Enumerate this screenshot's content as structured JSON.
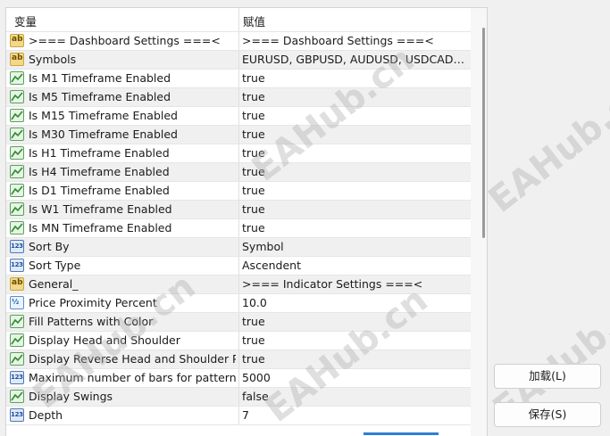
{
  "header": {
    "col_name": "变量",
    "col_value": "赋值"
  },
  "rows": [
    {
      "icon": "string",
      "name": ">=== Dashboard Settings ===<",
      "value": ">=== Dashboard Settings ===<"
    },
    {
      "icon": "string",
      "name": "Symbols",
      "value": "EURUSD, GBPUSD, AUDUSD, USDCAD, USDCHF"
    },
    {
      "icon": "bool",
      "name": "Is M1 Timeframe Enabled",
      "value": "true"
    },
    {
      "icon": "bool",
      "name": "Is M5 Timeframe Enabled",
      "value": "true"
    },
    {
      "icon": "bool",
      "name": "Is M15 Timeframe Enabled",
      "value": "true"
    },
    {
      "icon": "bool",
      "name": "Is M30 Timeframe Enabled",
      "value": "true"
    },
    {
      "icon": "bool",
      "name": "Is H1 Timeframe Enabled",
      "value": "true"
    },
    {
      "icon": "bool",
      "name": "Is H4 Timeframe Enabled",
      "value": "true"
    },
    {
      "icon": "bool",
      "name": "Is D1 Timeframe Enabled",
      "value": "true"
    },
    {
      "icon": "bool",
      "name": "Is W1 Timeframe Enabled",
      "value": "true"
    },
    {
      "icon": "bool",
      "name": "Is MN Timeframe Enabled",
      "value": "true"
    },
    {
      "icon": "int",
      "name": "Sort By",
      "value": "Symbol"
    },
    {
      "icon": "int",
      "name": "Sort Type",
      "value": "Ascendent"
    },
    {
      "icon": "string",
      "name": "General_",
      "value": ">=== Indicator Settings ===<"
    },
    {
      "icon": "double",
      "name": "Price Proximity Percent",
      "value": "10.0"
    },
    {
      "icon": "bool",
      "name": "Fill Patterns with Color",
      "value": "true"
    },
    {
      "icon": "bool",
      "name": "Display Head and Shoulder",
      "value": "true"
    },
    {
      "icon": "bool",
      "name": "Display Reverse Head and Shoulder Pattern",
      "value": "true"
    },
    {
      "icon": "int",
      "name": "Maximum number of bars for pattern",
      "value": "5000"
    },
    {
      "icon": "bool",
      "name": "Display Swings",
      "value": "false"
    },
    {
      "icon": "int",
      "name": "Depth",
      "value": "7"
    }
  ],
  "icon_glyphs": {
    "string": "ab",
    "int": "123",
    "double": "½"
  },
  "buttons": {
    "load": "加载(L)",
    "save": "保存(S)"
  },
  "watermark": "EAHub.cn",
  "colors": {
    "row_alt": "#f0f0f0",
    "accent": "#2f7fd1"
  }
}
